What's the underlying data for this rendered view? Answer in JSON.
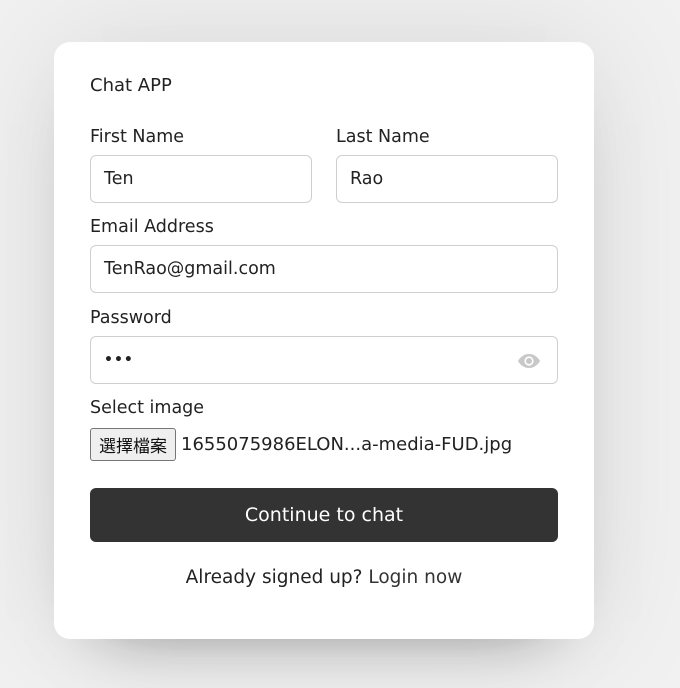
{
  "app": {
    "title": "Chat APP"
  },
  "form": {
    "first_name": {
      "label": "First Name",
      "value": "Ten"
    },
    "last_name": {
      "label": "Last Name",
      "value": "Rao"
    },
    "email": {
      "label": "Email Address",
      "value": "TenRao@gmail.com"
    },
    "password": {
      "label": "Password",
      "masked_value": "•••",
      "toggle_icon": "eye-icon"
    },
    "image": {
      "label": "Select image",
      "button_label": "選擇檔案",
      "file_name": "1655075986ELON...a-media-FUD.jpg"
    },
    "submit_label": "Continue to chat"
  },
  "footer": {
    "prompt": "Already signed up?",
    "link_label": "Login now"
  },
  "colors": {
    "page_background": "#f1f1f1",
    "card_background": "#ffffff",
    "button_background": "#333333",
    "button_text": "#ffffff",
    "input_border": "#cfcfcf",
    "icon_gray": "#c8c8c8"
  }
}
